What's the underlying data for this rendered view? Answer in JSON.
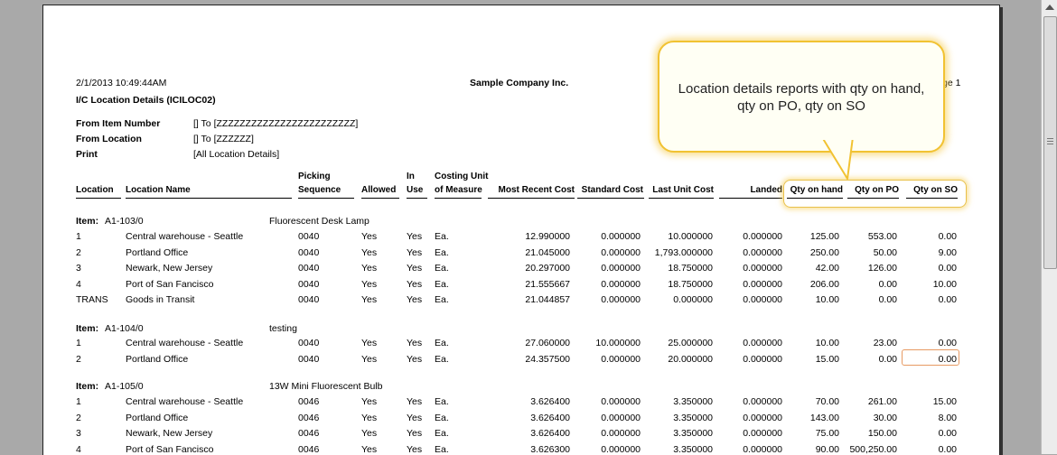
{
  "report": {
    "datetime": "2/1/2013  10:49:44AM",
    "company": "Sample Company Inc.",
    "page": "ge 1",
    "title": "I/C Location Details (ICILOC02)",
    "params": [
      {
        "label": "From Item Number",
        "value": "[]  To  [ZZZZZZZZZZZZZZZZZZZZZZZZ]"
      },
      {
        "label": "From Location",
        "value": "[]  To  [ZZZZZZ]"
      },
      {
        "label": "Print",
        "value": "[All Location Details]"
      }
    ]
  },
  "headers": {
    "location": "Location",
    "location_name": "Location Name",
    "picking_1": "Picking",
    "picking_2": "Sequence",
    "allowed": "Allowed",
    "in_use_1": "In",
    "in_use_2": "Use",
    "costing_1": "Costing Unit",
    "costing_2": "of Measure",
    "most_recent_cost": "Most Recent Cost",
    "standard_cost": "Standard Cost",
    "last_unit_cost": "Last Unit Cost",
    "landed": "Landed",
    "qty_on_hand": "Qty on hand",
    "qty_on_po": "Qty on PO",
    "qty_on_so": "Qty on SO"
  },
  "item_label": "Item:",
  "items": [
    {
      "code": "A1-103/0",
      "desc": "Fluorescent Desk Lamp",
      "rows": [
        [
          "1",
          "Central warehouse - Seattle",
          "0040",
          "Yes",
          "Yes",
          "Ea.",
          "12.990000",
          "0.000000",
          "10.000000",
          "0.000000",
          "125.00",
          "553.00",
          "0.00"
        ],
        [
          "2",
          "Portland Office",
          "0040",
          "Yes",
          "Yes",
          "Ea.",
          "21.045000",
          "0.000000",
          "1,793.000000",
          "0.000000",
          "250.00",
          "50.00",
          "9.00"
        ],
        [
          "3",
          "Newark, New Jersey",
          "0040",
          "Yes",
          "Yes",
          "Ea.",
          "20.297000",
          "0.000000",
          "18.750000",
          "0.000000",
          "42.00",
          "126.00",
          "0.00"
        ],
        [
          "4",
          "Port of San Fancisco",
          "0040",
          "Yes",
          "Yes",
          "Ea.",
          "21.555667",
          "0.000000",
          "18.750000",
          "0.000000",
          "206.00",
          "0.00",
          "10.00"
        ],
        [
          "TRANS",
          "Goods in Transit",
          "0040",
          "Yes",
          "Yes",
          "Ea.",
          "21.044857",
          "0.000000",
          "0.000000",
          "0.000000",
          "10.00",
          "0.00",
          "0.00"
        ]
      ]
    },
    {
      "code": "A1-104/0",
      "desc": "testing",
      "rows": [
        [
          "1",
          "Central warehouse - Seattle",
          "0040",
          "Yes",
          "Yes",
          "Ea.",
          "27.060000",
          "10.000000",
          "25.000000",
          "0.000000",
          "10.00",
          "23.00",
          "0.00"
        ],
        [
          "2",
          "Portland Office",
          "0040",
          "Yes",
          "Yes",
          "Ea.",
          "24.357500",
          "0.000000",
          "20.000000",
          "0.000000",
          "15.00",
          "0.00",
          "0.00"
        ]
      ]
    },
    {
      "code": "A1-105/0",
      "desc": "13W Mini Fluorescent Bulb",
      "rows": [
        [
          "1",
          "Central warehouse - Seattle",
          "0046",
          "Yes",
          "Yes",
          "Ea.",
          "3.626400",
          "0.000000",
          "3.350000",
          "0.000000",
          "70.00",
          "261.00",
          "15.00"
        ],
        [
          "2",
          "Portland Office",
          "0046",
          "Yes",
          "Yes",
          "Ea.",
          "3.626400",
          "0.000000",
          "3.350000",
          "0.000000",
          "143.00",
          "30.00",
          "8.00"
        ],
        [
          "3",
          "Newark, New Jersey",
          "0046",
          "Yes",
          "Yes",
          "Ea.",
          "3.626400",
          "0.000000",
          "3.350000",
          "0.000000",
          "75.00",
          "150.00",
          "0.00"
        ],
        [
          "4",
          "Port of San Fancisco",
          "0046",
          "Yes",
          "Yes",
          "Ea.",
          "3.626300",
          "0.000000",
          "3.350000",
          "0.000000",
          "90.00",
          "500,250.00",
          "0.00"
        ]
      ]
    }
  ],
  "callout": {
    "text": "Location details reports with qty on hand, qty on PO, qty on SO"
  },
  "colors": {
    "callout_border": "#f1c232",
    "callout_glow": "#f6cd50",
    "selected_cell_border": "#e79a63"
  }
}
